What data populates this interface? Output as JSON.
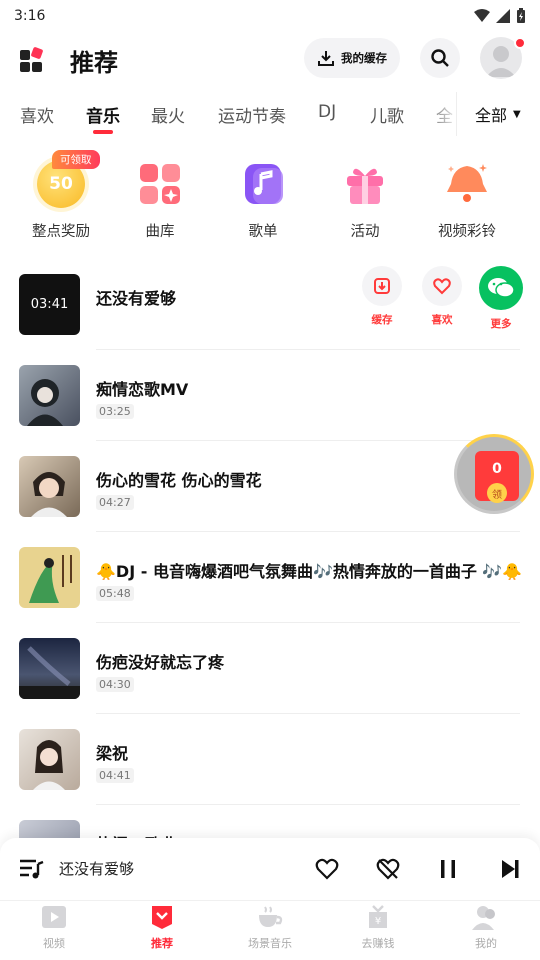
{
  "status_bar": {
    "time": "3:16"
  },
  "header": {
    "title": "推荐",
    "cache_label": "我的缓存"
  },
  "tabs": [
    {
      "label": "喜欢"
    },
    {
      "label": "音乐"
    },
    {
      "label": "最火"
    },
    {
      "label": "运动节奏"
    },
    {
      "label": "DJ"
    },
    {
      "label": "儿歌"
    },
    {
      "label": "全"
    }
  ],
  "tab_all": "全部",
  "shortcuts": [
    {
      "label": "整点奖励",
      "badge": "可领取",
      "coin_value": "50"
    },
    {
      "label": "曲库"
    },
    {
      "label": "歌单"
    },
    {
      "label": "活动"
    },
    {
      "label": "视频彩铃"
    }
  ],
  "songs": [
    {
      "title": "还没有爱够",
      "duration": "03:41"
    },
    {
      "title": "痴情恋歌MV",
      "duration": "03:25"
    },
    {
      "title": "伤心的雪花 伤心的雪花",
      "duration": "04:27"
    },
    {
      "title": "🐥DJ - 电音嗨爆酒吧气氛舞曲🎶热情奔放的一首曲子 🎶🐥",
      "duration": "05:48"
    },
    {
      "title": "伤疤没好就忘了疼",
      "duration": "04:30"
    },
    {
      "title": "梁祝",
      "duration": "04:41"
    },
    {
      "title": "热门dj歌曲"
    }
  ],
  "song_actions": {
    "cache": "缓存",
    "like": "喜欢",
    "more": "更多"
  },
  "red_packet": {
    "count": "0",
    "claim": "领"
  },
  "player": {
    "title": "还没有爱够"
  },
  "bottom_nav": [
    {
      "label": "视频"
    },
    {
      "label": "推荐"
    },
    {
      "label": "场景音乐"
    },
    {
      "label": "去赚钱"
    },
    {
      "label": "我的"
    }
  ],
  "colors": {
    "accent": "#ff2b3a",
    "wechat": "#07c160"
  }
}
